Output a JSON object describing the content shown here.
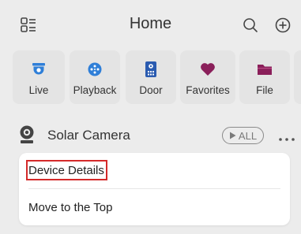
{
  "header": {
    "title": "Home",
    "menu_icon": "list-menu-icon",
    "search_icon": "search-icon",
    "add_icon": "plus-circle-icon"
  },
  "tiles": [
    {
      "label": "Live",
      "icon": "camera-icon",
      "color": "#2f7fd8"
    },
    {
      "label": "Playback",
      "icon": "film-reel-icon",
      "color": "#2f7fd8"
    },
    {
      "label": "Door",
      "icon": "door-intercom-icon",
      "color": "#2a5bb0"
    },
    {
      "label": "Favorites",
      "icon": "heart-icon",
      "color": "#8a1f5a"
    },
    {
      "label": "File",
      "icon": "folder-icon",
      "color": "#8a1f5a"
    }
  ],
  "device": {
    "name": "Solar Camera",
    "all_label": "ALL",
    "icon": "camera-device-icon",
    "more_icon": "more-dots-icon"
  },
  "popup_menu": {
    "items": [
      {
        "label": "Device Details",
        "highlighted": true
      },
      {
        "label": "Move to the Top",
        "highlighted": false
      }
    ],
    "highlight_color": "#d42a2a"
  },
  "colors": {
    "background": "#ececec",
    "tile_background": "#e4e4e4",
    "popup_background": "#ffffff"
  }
}
